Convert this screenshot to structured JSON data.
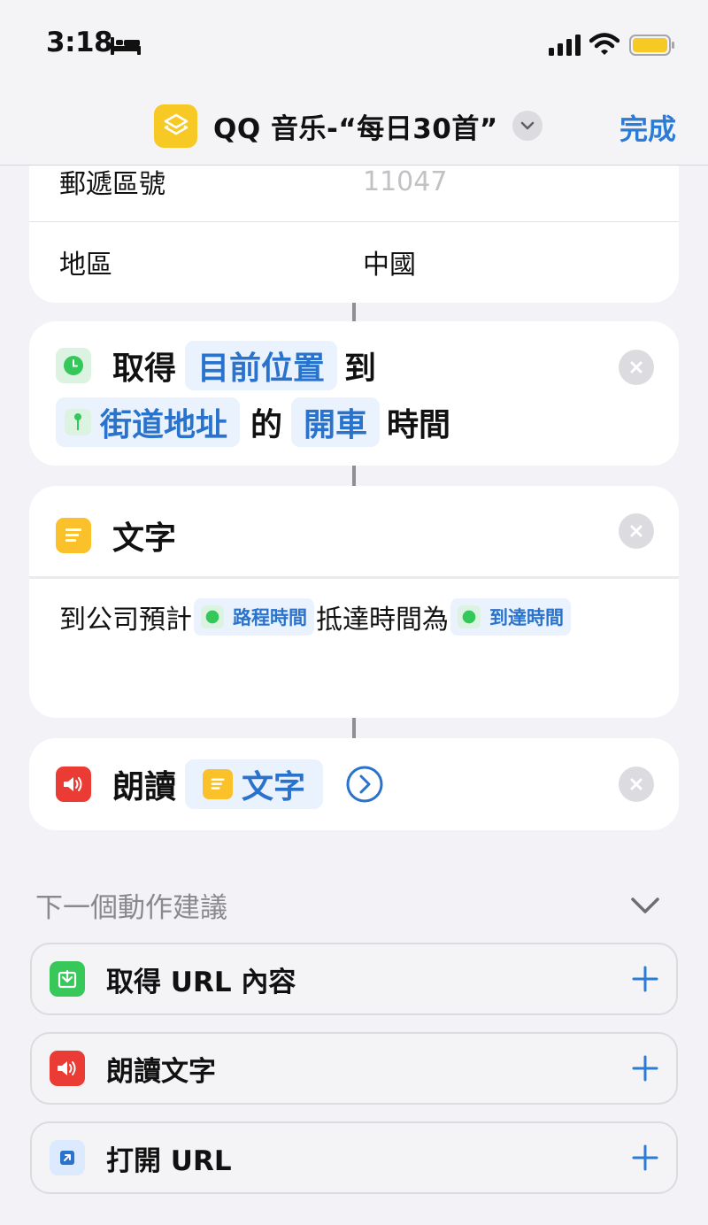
{
  "status_bar": {
    "time": "3:18"
  },
  "nav": {
    "shortcut_title": "QQ 音乐-“每日30首”",
    "done_label": "完成"
  },
  "address_card": {
    "postal_label": "郵遞區號",
    "postal_value": "11047",
    "region_label": "地區",
    "region_value": "中國"
  },
  "travel_action": {
    "verb": "取得",
    "origin_token": "目前位置",
    "to_word": "到",
    "destination_token": "街道地址",
    "of_word": "的",
    "mode_token": "開車",
    "result_word": "時間"
  },
  "text_action": {
    "title": "文字",
    "body_prefix": "到公司預計",
    "var1": "路程時間",
    "body_middle": "抵達時間為",
    "var2": "到達時間"
  },
  "speak_action": {
    "verb": "朗讀",
    "input_token": "文字"
  },
  "suggestions": {
    "header": "下一個動作建議",
    "items": [
      {
        "label": "取得 URL 內容",
        "icon": "download-icon",
        "color": "#38c85a"
      },
      {
        "label": "朗讀文字",
        "icon": "speaker-icon",
        "color": "#ea3b35"
      },
      {
        "label": "打開 URL",
        "icon": "open-url-icon",
        "color": "#2a73cc"
      }
    ]
  },
  "colors": {
    "accent": "#2c7bd4",
    "app_icon": "#f6c924",
    "battery": "#f6c924"
  }
}
